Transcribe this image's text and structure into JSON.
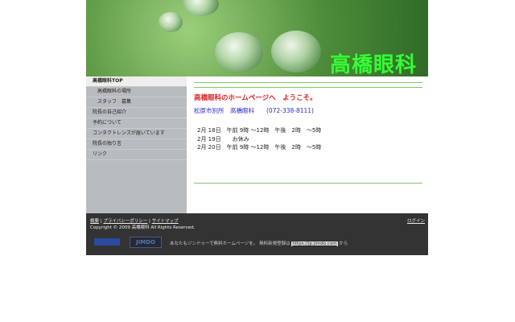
{
  "header": {
    "logo": "高橋眼科"
  },
  "sidebar": {
    "items": [
      {
        "label": "高橋眼科TOP",
        "active": true
      },
      {
        "label": "高橋眼科の場所",
        "sub": true
      },
      {
        "label": "スタッフ　募集",
        "sub": true
      },
      {
        "label": "院長の自己紹介"
      },
      {
        "label": "予約について"
      },
      {
        "label": "コンタクトレンズが届いています"
      },
      {
        "label": "院長の独り言"
      },
      {
        "label": "リンク"
      }
    ]
  },
  "content": {
    "welcome": "高橋眼科のホームページへ　ようこそ。",
    "address": "松原市別所　高橋眼科　　(072-338-8111)",
    "schedule": [
      "2月 18日　午前 9時 ～12時　午後　2時　～5時",
      "2月 19日　　お休み",
      "2月 20日　午前 9時 ～12時　午後　2時　～5時"
    ]
  },
  "footer": {
    "links": [
      "概要",
      "プライバシーポリシー",
      "サイトマップ"
    ],
    "sep": " | ",
    "copyright": "Copyright © 2009 高橋眼科 All Rights Reserved.",
    "login": "ログイン",
    "jimdo": "JIMDO",
    "promo": "あなたもジンドゥーで無料ホームページを。 無料新規登録は",
    "promo_link": "https://jp.jimdo.com",
    "promo_end": " から"
  }
}
